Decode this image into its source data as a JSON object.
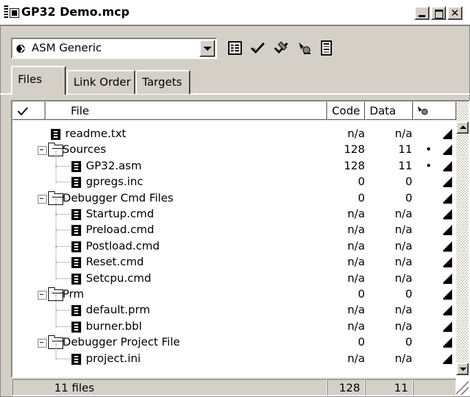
{
  "window": {
    "title": "GP32 Demo.mcp"
  },
  "toolbar": {
    "target": "ASM Generic"
  },
  "tabs": [
    {
      "label": "Files",
      "active": true
    },
    {
      "label": "Link Order",
      "active": false
    },
    {
      "label": "Targets",
      "active": false
    }
  ],
  "columns": {
    "file": "File",
    "code": "Code",
    "data": "Data"
  },
  "tree": [
    {
      "name": "readme.txt",
      "type": "file",
      "level": 0,
      "code": "n/a",
      "data": "n/a",
      "dot": ""
    },
    {
      "name": "Sources",
      "type": "folder",
      "level": 0,
      "code": "128",
      "data": "11",
      "dot": "•"
    },
    {
      "name": "GP32.asm",
      "type": "file",
      "level": 1,
      "code": "128",
      "data": "11",
      "dot": "•"
    },
    {
      "name": "gpregs.inc",
      "type": "file",
      "level": 1,
      "code": "0",
      "data": "0",
      "dot": ""
    },
    {
      "name": "Debugger Cmd Files",
      "type": "folder",
      "level": 0,
      "code": "0",
      "data": "0",
      "dot": ""
    },
    {
      "name": "Startup.cmd",
      "type": "file",
      "level": 1,
      "code": "n/a",
      "data": "n/a",
      "dot": ""
    },
    {
      "name": "Preload.cmd",
      "type": "file",
      "level": 1,
      "code": "n/a",
      "data": "n/a",
      "dot": ""
    },
    {
      "name": "Postload.cmd",
      "type": "file",
      "level": 1,
      "code": "n/a",
      "data": "n/a",
      "dot": ""
    },
    {
      "name": "Reset.cmd",
      "type": "file",
      "level": 1,
      "code": "n/a",
      "data": "n/a",
      "dot": ""
    },
    {
      "name": "Setcpu.cmd",
      "type": "file",
      "level": 1,
      "code": "n/a",
      "data": "n/a",
      "dot": ""
    },
    {
      "name": "Prm",
      "type": "folder",
      "level": 0,
      "code": "0",
      "data": "0",
      "dot": ""
    },
    {
      "name": "default.prm",
      "type": "file",
      "level": 1,
      "code": "n/a",
      "data": "n/a",
      "dot": ""
    },
    {
      "name": "burner.bbl",
      "type": "file",
      "level": 1,
      "code": "n/a",
      "data": "n/a",
      "dot": ""
    },
    {
      "name": "Debugger Project File",
      "type": "folder",
      "level": 0,
      "code": "0",
      "data": "0",
      "dot": ""
    },
    {
      "name": "project.ini",
      "type": "file",
      "level": 1,
      "code": "n/a",
      "data": "n/a",
      "dot": ""
    }
  ],
  "footer": {
    "count": "11 files",
    "code": "128",
    "data": "11"
  },
  "icons": {
    "toolbar": [
      "target-settings-icon",
      "checkmark-icon",
      "make-icon",
      "debug-icon",
      "run-icon",
      "project-inspector-icon"
    ]
  }
}
